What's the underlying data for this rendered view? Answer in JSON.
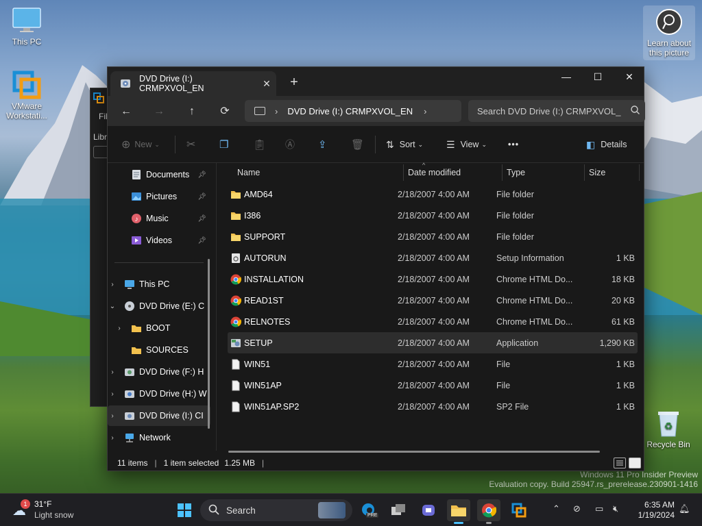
{
  "desktop": {
    "icons": [
      {
        "label": "This PC"
      },
      {
        "label": "VMware Workstati..."
      },
      {
        "label": "Learn about this picture"
      },
      {
        "label": "Recycle Bin"
      }
    ],
    "watermark_line1": "Windows 11 Pro Insider Preview",
    "watermark_line2": "Evaluation copy. Build 25947.rs_prerelease.230901-1416"
  },
  "behind_window": {
    "fragments": [
      "Fil",
      "Libr"
    ]
  },
  "explorer": {
    "tab_title": "DVD Drive (I:) CRMPXVOL_EN",
    "tab_close": "✕",
    "new_tab": "+",
    "window_controls": {
      "minimize": "—",
      "maximize": "☐",
      "close": "✕"
    },
    "address": {
      "crumb": "DVD Drive (I:) CRMPXVOL_EN"
    },
    "search_placeholder": "Search DVD Drive (I:) CRMPXVOL_EN",
    "toolbar": {
      "new_label": "New",
      "sort_label": "Sort",
      "view_label": "View",
      "more_label": "•••",
      "details_label": "Details"
    },
    "nav": {
      "quick": [
        {
          "label": "Documents",
          "icon": "documents-icon"
        },
        {
          "label": "Pictures",
          "icon": "pictures-icon"
        },
        {
          "label": "Music",
          "icon": "music-icon"
        },
        {
          "label": "Videos",
          "icon": "videos-icon"
        }
      ],
      "tree": [
        {
          "label": "This PC"
        },
        {
          "label": "DVD Drive (E:) C"
        },
        {
          "label": "BOOT"
        },
        {
          "label": "SOURCES"
        },
        {
          "label": "DVD Drive (F:) H"
        },
        {
          "label": "DVD Drive (H:) W"
        },
        {
          "label": "DVD Drive (I:) CI"
        },
        {
          "label": "Network"
        }
      ]
    },
    "columns": {
      "name": "Name",
      "date": "Date modified",
      "type": "Type",
      "size": "Size"
    },
    "files": [
      {
        "name": "AMD64",
        "date": "2/18/2007 4:00 AM",
        "type": "File folder",
        "size": "",
        "icon": "folder-icon"
      },
      {
        "name": "I386",
        "date": "2/18/2007 4:00 AM",
        "type": "File folder",
        "size": "",
        "icon": "folder-icon"
      },
      {
        "name": "SUPPORT",
        "date": "2/18/2007 4:00 AM",
        "type": "File folder",
        "size": "",
        "icon": "folder-icon"
      },
      {
        "name": "AUTORUN",
        "date": "2/18/2007 4:00 AM",
        "type": "Setup Information",
        "size": "1 KB",
        "icon": "settings-file-icon"
      },
      {
        "name": "INSTALLATION",
        "date": "2/18/2007 4:00 AM",
        "type": "Chrome HTML Do...",
        "size": "18 KB",
        "icon": "chrome-icon"
      },
      {
        "name": "READ1ST",
        "date": "2/18/2007 4:00 AM",
        "type": "Chrome HTML Do...",
        "size": "20 KB",
        "icon": "chrome-icon"
      },
      {
        "name": "RELNOTES",
        "date": "2/18/2007 4:00 AM",
        "type": "Chrome HTML Do...",
        "size": "61 KB",
        "icon": "chrome-icon"
      },
      {
        "name": "SETUP",
        "date": "2/18/2007 4:00 AM",
        "type": "Application",
        "size": "1,290 KB",
        "icon": "setup-app-icon"
      },
      {
        "name": "WIN51",
        "date": "2/18/2007 4:00 AM",
        "type": "File",
        "size": "1 KB",
        "icon": "file-icon"
      },
      {
        "name": "WIN51AP",
        "date": "2/18/2007 4:00 AM",
        "type": "File",
        "size": "1 KB",
        "icon": "file-icon"
      },
      {
        "name": "WIN51AP.SP2",
        "date": "2/18/2007 4:00 AM",
        "type": "SP2 File",
        "size": "1 KB",
        "icon": "file-icon"
      }
    ],
    "status": {
      "items": "11 items",
      "selected": "1 item selected",
      "size": "1.25 MB",
      "sep": "|"
    }
  },
  "taskbar": {
    "weather_temp": "31°F",
    "weather_desc": "Light snow",
    "weather_badge": "1",
    "search_label": "Search",
    "pre_badge": "PRE",
    "time": "6:35 AM",
    "date": "1/19/2024"
  },
  "colors": {
    "accent": "#4cc2ff",
    "folder": "#f2c14e",
    "selection": "#2d2d2d",
    "window_bg": "#191919"
  }
}
